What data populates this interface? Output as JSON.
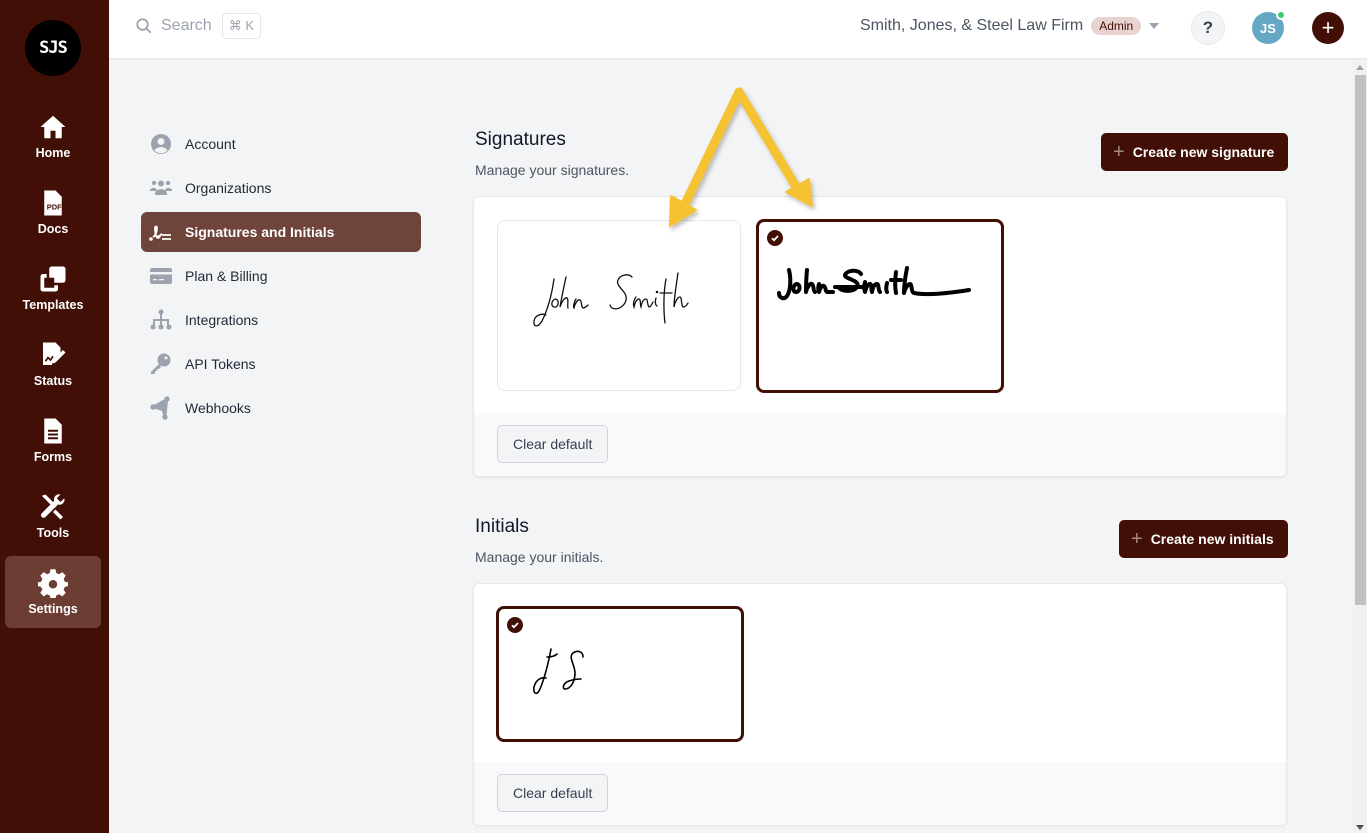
{
  "brand": {
    "logo_text": "SJS",
    "accent": "#410f05",
    "active_nav_bg": "#6f443a",
    "annotation_color": "#f5c232"
  },
  "rail": {
    "items": [
      {
        "label": "Home",
        "icon": "home-icon",
        "active": false
      },
      {
        "label": "Docs",
        "icon": "pdf-file-icon",
        "active": false
      },
      {
        "label": "Templates",
        "icon": "templates-icon",
        "active": false
      },
      {
        "label": "Status",
        "icon": "signature-status-icon",
        "active": false
      },
      {
        "label": "Forms",
        "icon": "form-file-icon",
        "active": false
      },
      {
        "label": "Tools",
        "icon": "tools-icon",
        "active": false
      },
      {
        "label": "Settings",
        "icon": "gear-icon",
        "active": true
      }
    ]
  },
  "header": {
    "search_placeholder": "Search",
    "search_shortcut": "⌘ K",
    "org_name": "Smith, Jones, & Steel Law Firm",
    "role_badge": "Admin",
    "help_label": "?",
    "avatar_initials": "JS",
    "plus_label": "+"
  },
  "settings_nav": {
    "items": [
      {
        "label": "Account",
        "icon": "user-circle-icon",
        "active": false
      },
      {
        "label": "Organizations",
        "icon": "users-icon",
        "active": false
      },
      {
        "label": "Signatures and Initials",
        "icon": "signature-icon",
        "active": true
      },
      {
        "label": "Plan & Billing",
        "icon": "credit-card-icon",
        "active": false
      },
      {
        "label": "Integrations",
        "icon": "sitemap-icon",
        "active": false
      },
      {
        "label": "API Tokens",
        "icon": "key-icon",
        "active": false
      },
      {
        "label": "Webhooks",
        "icon": "webhook-icon",
        "active": false
      }
    ]
  },
  "signatures": {
    "title": "Signatures",
    "subtitle": "Manage your signatures.",
    "create_label": "Create new signature",
    "items": [
      {
        "text": "John Smith",
        "style": "thin-script",
        "default": false
      },
      {
        "text": "John Smith",
        "style": "bold-script",
        "default": true
      }
    ],
    "clear_label": "Clear default"
  },
  "initials": {
    "title": "Initials",
    "subtitle": "Manage your initials.",
    "create_label": "Create new initials",
    "items": [
      {
        "text": "JS",
        "style": "thin-script",
        "default": true
      }
    ],
    "clear_label": "Clear default"
  }
}
